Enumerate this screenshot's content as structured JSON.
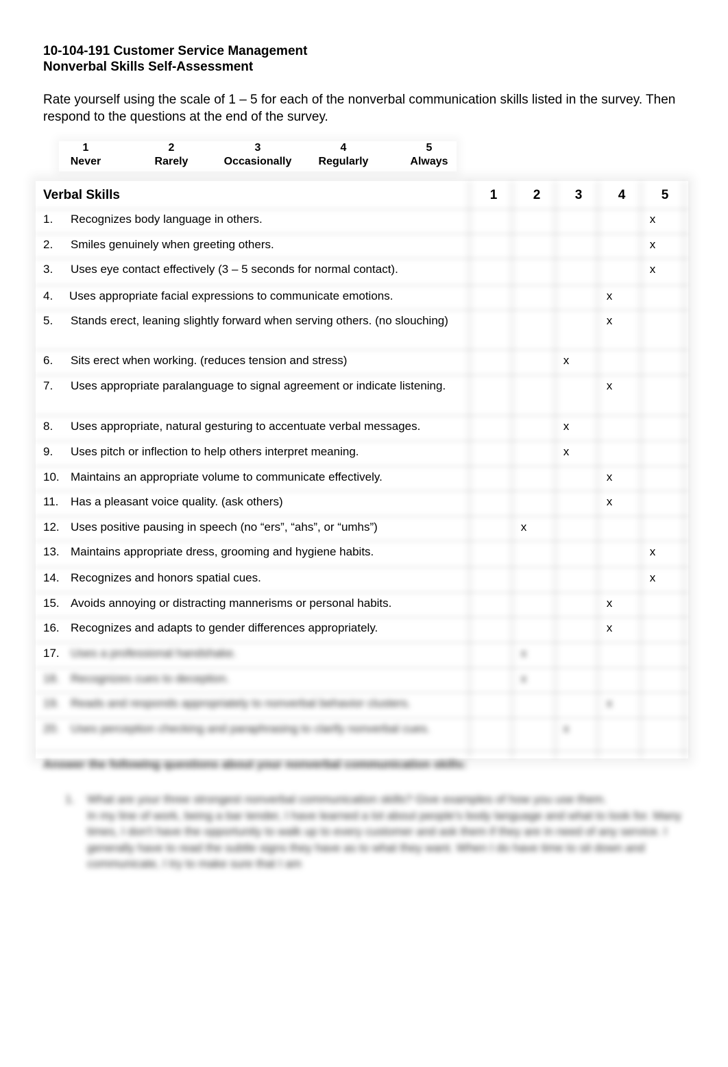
{
  "document": {
    "title_line1": "10-104-191 Customer Service Management",
    "title_line2": "Nonverbal Skills Self-Assessment",
    "instructions": "Rate yourself using the scale of 1 – 5 for each of the nonverbal communication skills listed in the survey.  Then respond to the questions at the end of the survey."
  },
  "scale": [
    {
      "value": "1",
      "label": "Never"
    },
    {
      "value": "2",
      "label": "Rarely"
    },
    {
      "value": "3",
      "label": "Occasionally"
    },
    {
      "value": "4",
      "label": "Regularly"
    },
    {
      "value": "5",
      "label": "Always"
    }
  ],
  "table": {
    "header_label": "Verbal Skills",
    "columns": [
      "1",
      "2",
      "3",
      "4",
      "5"
    ],
    "mark_symbol": "x",
    "rows": [
      {
        "num": "1.",
        "text": "Recognizes body language in others.",
        "rating": 5
      },
      {
        "num": "2.",
        "text": "Smiles genuinely when greeting others.",
        "rating": 5
      },
      {
        "num": "3.",
        "text": "Uses eye contact effectively (3 – 5 seconds for normal contact).",
        "rating": 5
      },
      {
        "num": "4.",
        "text": "Uses appropriate facial expressions to communicate emotions.",
        "rating": 4
      },
      {
        "num": "5.",
        "text": "Stands erect, leaning slightly forward when serving others.  (no slouching)",
        "rating": 4
      },
      {
        "num": "6.",
        "text": "Sits erect when working. (reduces tension and stress)",
        "rating": 3
      },
      {
        "num": "7.",
        "text": "Uses appropriate paralanguage to signal agreement or indicate listening.",
        "rating": 4
      },
      {
        "num": "8.",
        "text": "Uses appropriate, natural gesturing to accentuate verbal messages.",
        "rating": 3
      },
      {
        "num": "9.",
        "text": "Uses pitch or inflection to help others interpret meaning.",
        "rating": 3
      },
      {
        "num": "10.",
        "text": "Maintains an appropriate volume to communicate effectively.",
        "rating": 4
      },
      {
        "num": "11.",
        "text": "Has a pleasant voice quality. (ask others)",
        "rating": 4
      },
      {
        "num": "12.",
        "text": "Uses positive pausing in speech (no “ers”, “ahs”, or “umhs”)",
        "rating": 2
      },
      {
        "num": "13.",
        "text": "Maintains appropriate dress, grooming and hygiene habits.",
        "rating": 5
      },
      {
        "num": "14.",
        "text": "Recognizes and honors spatial cues.",
        "rating": 5
      },
      {
        "num": "15.",
        "text": "Avoids annoying or distracting mannerisms or personal habits.",
        "rating": 4
      },
      {
        "num": "16.",
        "text": "Recognizes and adapts to gender differences appropriately.",
        "rating": 4
      },
      {
        "num": "17.",
        "text": "Uses a professional handshake.",
        "rating": 2,
        "blurred": true
      },
      {
        "num": "18.",
        "text": "Recognizes cues to deception.",
        "rating": 2,
        "blurred": true
      },
      {
        "num": "19.",
        "text": "Reads and responds appropriately to nonverbal behavior clusters.",
        "rating": 4,
        "blurred": true
      },
      {
        "num": "20.",
        "text": "Uses perception checking and paraphrasing to clarify nonverbal cues.",
        "rating": 3,
        "blurred": true
      }
    ]
  },
  "questions": {
    "heading": "Answer the following questions about your nonverbal communication skills:",
    "items": [
      {
        "num": "1.",
        "question": "What are your three strongest nonverbal communication skills? Give examples of how you use them.",
        "answer": "In my line of work, being a bar tender, I have learned a lot about people's body language and what to look for. Many times, I don't have the opportunity to walk up to every customer and ask them if they are in need of any service. I generally have to read the subtle signs they have as to what they want. When I do have time to sit down and communicate, I try to make sure that I am"
      }
    ]
  }
}
